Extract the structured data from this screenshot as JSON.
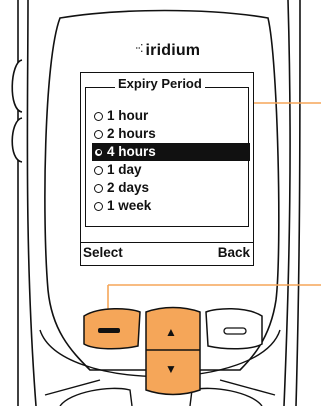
{
  "brand": {
    "name": "iridium",
    "dots": "‧‧⁚"
  },
  "screen": {
    "title": "Expiry Period",
    "options": [
      {
        "label": "1 hour",
        "checked": false,
        "selected": false
      },
      {
        "label": "2 hours",
        "checked": false,
        "selected": false
      },
      {
        "label": "4 hours",
        "checked": true,
        "selected": true
      },
      {
        "label": "1 day",
        "checked": false,
        "selected": false
      },
      {
        "label": "2 days",
        "checked": false,
        "selected": false
      },
      {
        "label": "1 week",
        "checked": false,
        "selected": false
      }
    ],
    "left_soft_key": "Select",
    "right_soft_key": "Back"
  },
  "icons": {
    "up": "▲",
    "down": "▼"
  },
  "colors": {
    "highlight_key": "#f5a659",
    "phone_body": "#ffffff",
    "outline": "#111111"
  }
}
